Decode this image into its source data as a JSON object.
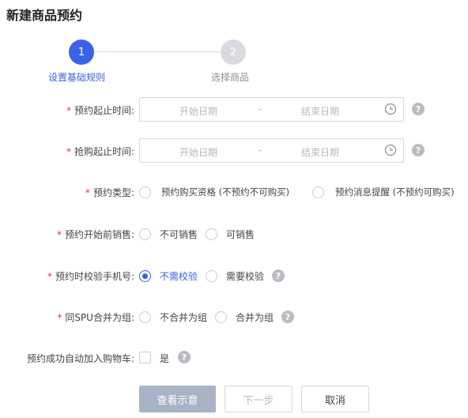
{
  "page": {
    "title": "新建商品预约"
  },
  "stepper": {
    "steps": [
      {
        "number": "1",
        "label": "设置基础规则",
        "state": "active"
      },
      {
        "number": "2",
        "label": "选择商品",
        "state": "pending"
      }
    ]
  },
  "form": {
    "required_mark": "*",
    "reserve_time": {
      "label": "预约起止时间:",
      "start_placeholder": "开始日期",
      "separator": "-",
      "end_placeholder": "结束日期",
      "help": "?"
    },
    "rush_time": {
      "label": "抢购起止时间:",
      "start_placeholder": "开始日期",
      "separator": "-",
      "end_placeholder": "结束日期",
      "help": "?"
    },
    "reserve_type": {
      "label": "预约类型:",
      "options": [
        "预约购买资格 (不预约不可购买)",
        "预约消息提醒 (不预约可购买)"
      ],
      "selected": null
    },
    "pre_sale": {
      "label": "预约开始前销售:",
      "options": [
        "不可销售",
        "可销售"
      ],
      "selected": null
    },
    "phone_verify": {
      "label": "预约时校验手机号:",
      "options": [
        "不需校验",
        "需要校验"
      ],
      "selected": "不需校验",
      "help": "?"
    },
    "spu_group": {
      "label": "同SPU合并为组:",
      "options": [
        "不合并为组",
        "合并为组"
      ],
      "selected": null,
      "help": "?"
    },
    "auto_cart": {
      "label": "预约成功自动加入购物车:",
      "checkbox_label": "是",
      "checked": false,
      "help": "?"
    }
  },
  "buttons": {
    "preview": "查看示意",
    "next": "下一步",
    "cancel": "取消"
  },
  "colors": {
    "accent": "#3a62e6",
    "required": "#e0393e",
    "disabled_button": "#a9b3c6"
  }
}
